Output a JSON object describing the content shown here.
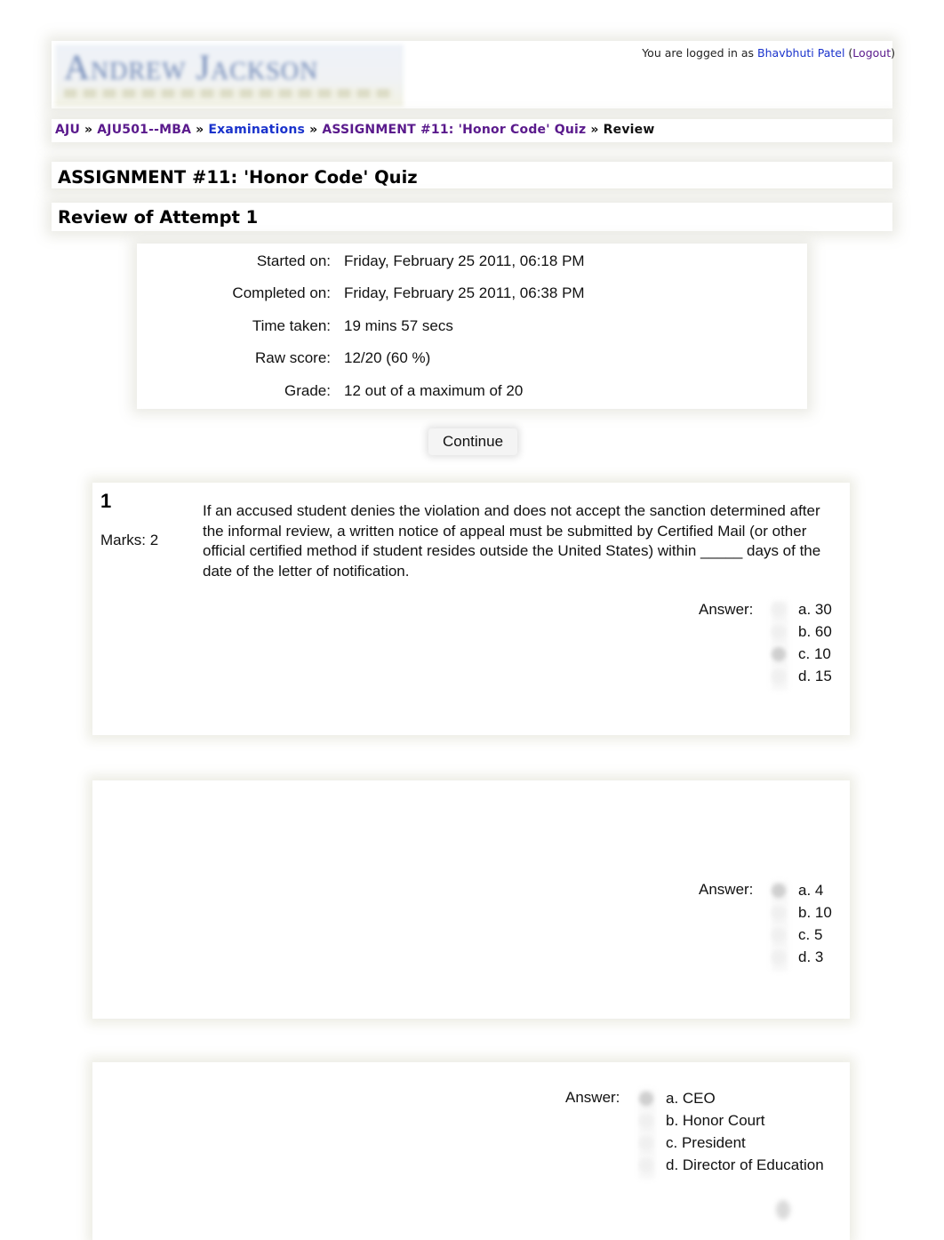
{
  "header": {
    "logo_text": "Andrew Jackson",
    "login_prefix": "You are logged in as",
    "user_name": "Bhavbhuti Patel",
    "logout_open": "(",
    "logout_label": "Logout",
    "logout_close": ")"
  },
  "breadcrumb": {
    "separator": "»",
    "items": [
      {
        "label": "AJU"
      },
      {
        "label": "AJU501--MBA"
      },
      {
        "label": "Examinations"
      },
      {
        "label": "ASSIGNMENT #11: 'Honor Code' Quiz"
      },
      {
        "label": "Review"
      }
    ]
  },
  "page": {
    "title": "ASSIGNMENT #11: 'Honor Code' Quiz",
    "subtitle": "Review of Attempt 1"
  },
  "summary": {
    "rows": [
      {
        "label": "Started on:",
        "value": "Friday, February 25 2011, 06:18 PM"
      },
      {
        "label": "Completed on:",
        "value": "Friday, February 25 2011, 06:38 PM"
      },
      {
        "label": "Time taken:",
        "value": "19 mins 57 secs"
      },
      {
        "label": "Raw score:",
        "value": "12/20 (60 %)"
      },
      {
        "label": "Grade:",
        "value": "12 out of a maximum of 20"
      }
    ]
  },
  "continue_label": "Continue",
  "questions": [
    {
      "number": "1",
      "marks": "Marks: 2",
      "text": "If an accused student denies the violation and does not accept the sanction determined after the informal review, a written notice of appeal must be submitted by Certified Mail (or other official certified method if student resides outside the United States) within _____ days of the date of the letter of notification.",
      "answer_label": "Answer:",
      "options": [
        "a. 30",
        "b. 60",
        "c. 10",
        "d. 15"
      ],
      "selected": "c"
    },
    {
      "answer_label": "Answer:",
      "options": [
        "a. 4",
        "b. 10",
        "c. 5",
        "d. 3"
      ],
      "selected": "a"
    },
    {
      "answer_label": "Answer:",
      "options": [
        "a. CEO",
        "b. Honor Court",
        "c. President",
        "d. Director of Education"
      ],
      "selected": "a"
    }
  ]
}
